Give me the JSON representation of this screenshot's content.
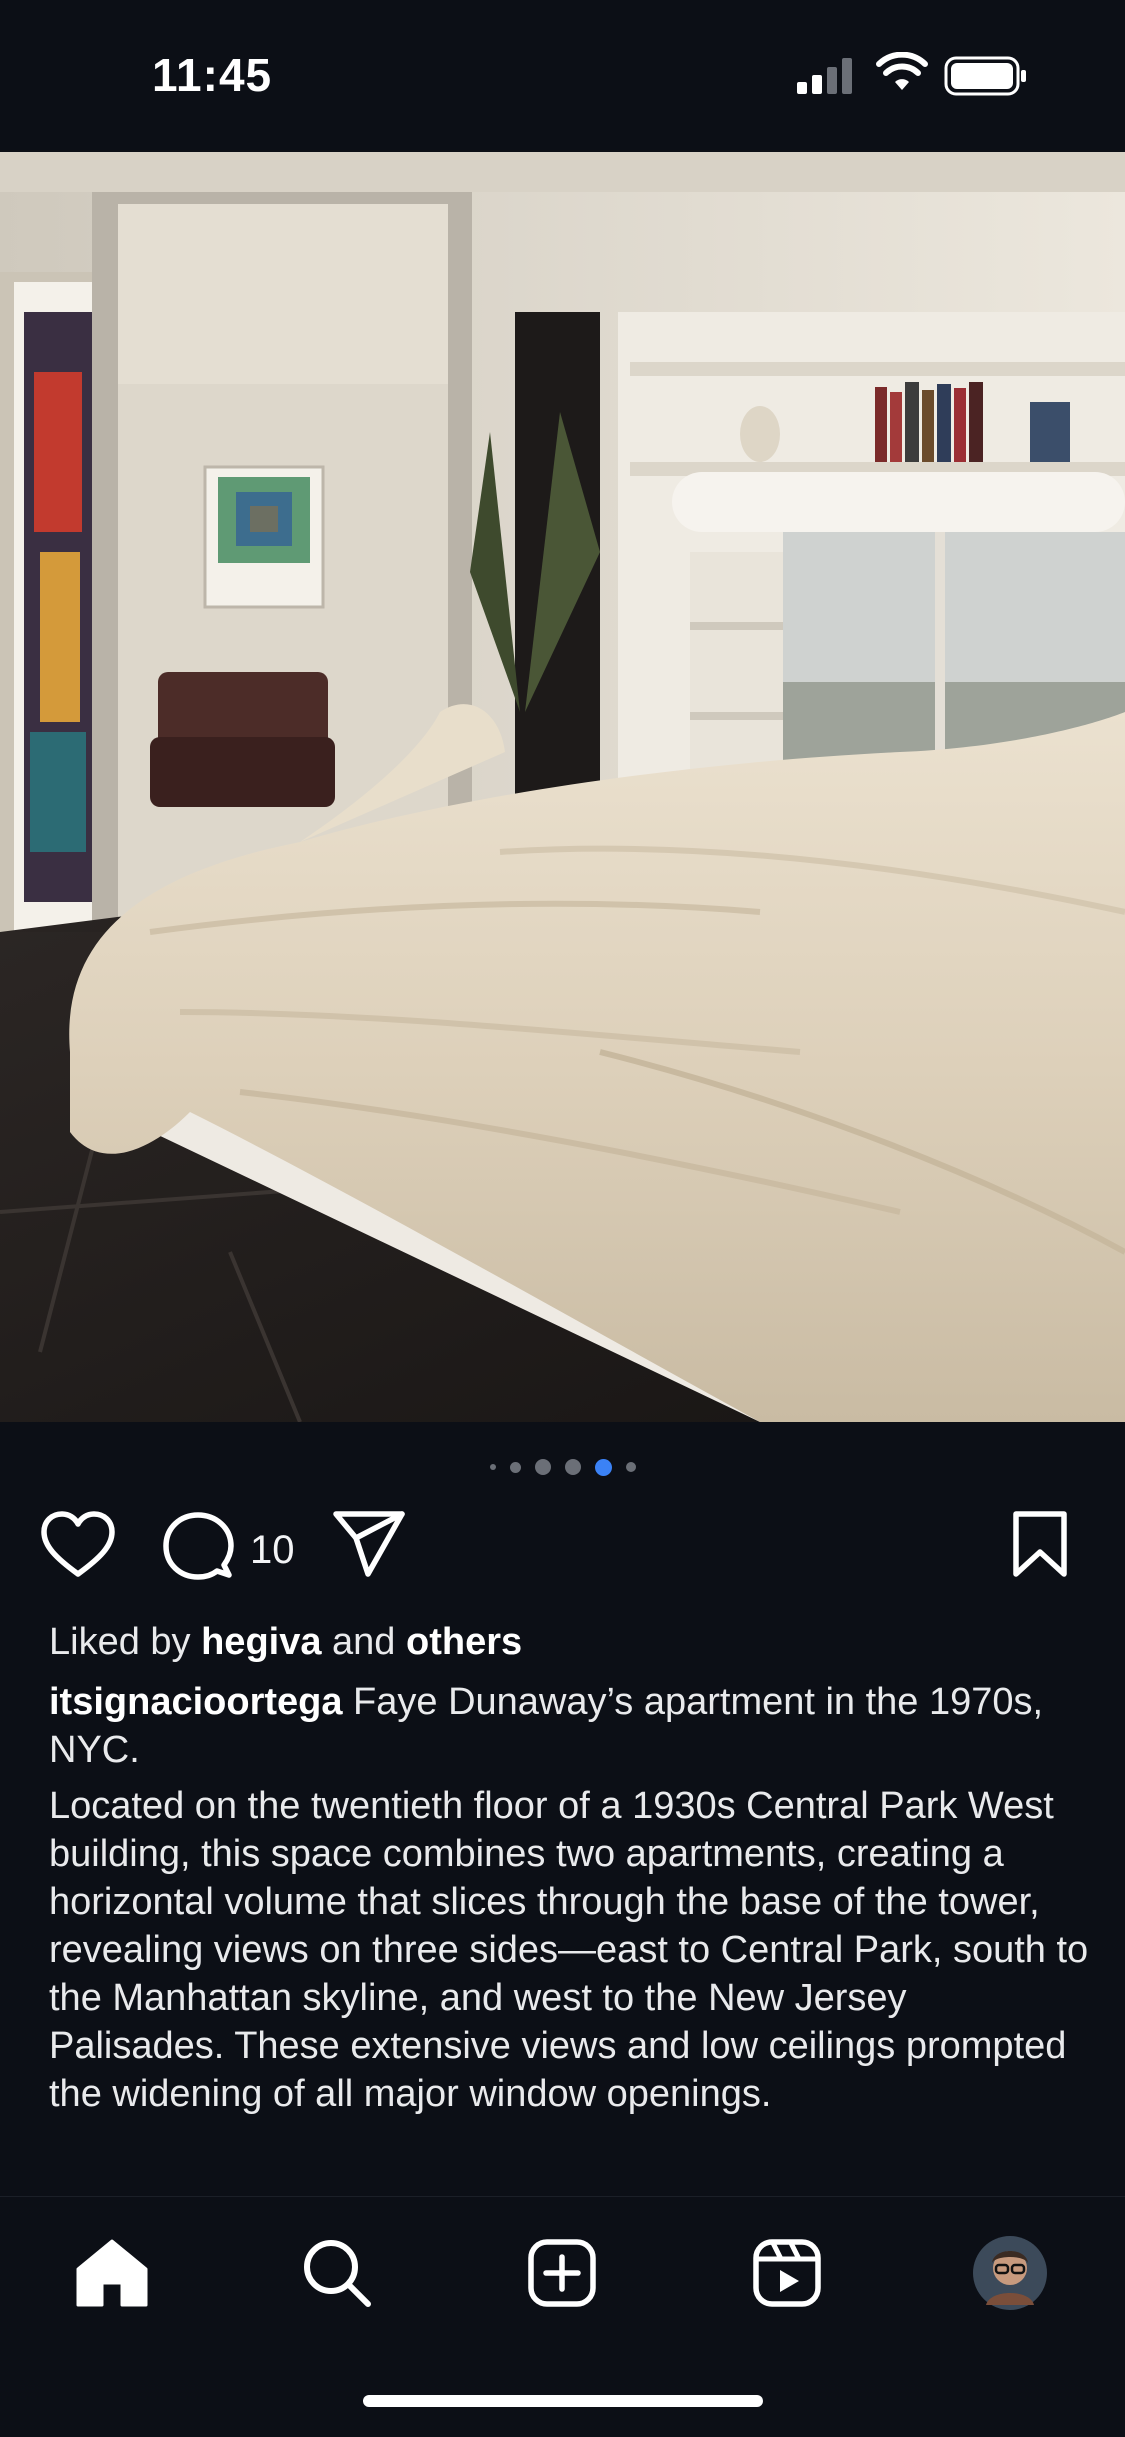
{
  "status": {
    "time": "11:45"
  },
  "post": {
    "carousel": {
      "count": 6,
      "active_index": 4
    },
    "comment_count": "10",
    "liked_by_prefix": "Liked by ",
    "liked_by_user": "hegiva",
    "liked_by_and": " and ",
    "liked_by_others": "others",
    "username": "itsignacioortega",
    "caption": " Faye Dunaway’s apartment in the 1970s, NYC.",
    "description": "Located on the twentieth floor of a 1930s Central Park West building, this space combines two apartments, creating a horizontal volume that slices through the base of the tower, revealing views on three sides—east to Central Park, south to the Manhattan skyline, and west to the New Jersey Palisades. These extensive views and low ceilings prompted the widening of all major window openings."
  },
  "icons": {
    "like": "heart-icon",
    "comment": "comment-icon",
    "share": "paper-plane-icon",
    "save": "bookmark-icon",
    "home": "home-icon",
    "search": "search-icon",
    "create": "plus-square-icon",
    "reels": "reels-icon"
  },
  "colors": {
    "background": "#0c0f16",
    "accent": "#3b82f6",
    "text": "#f3f4f6"
  }
}
